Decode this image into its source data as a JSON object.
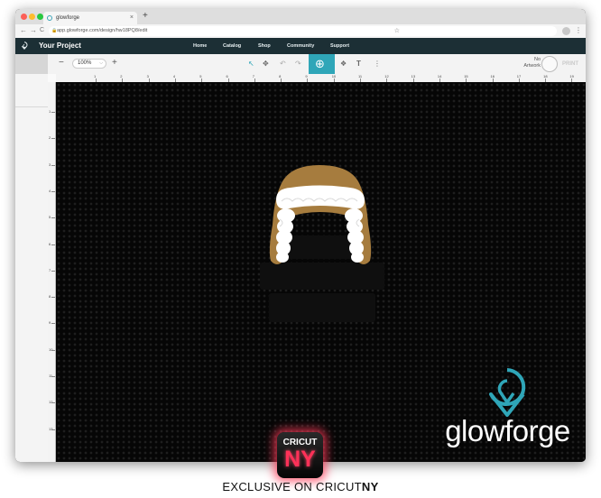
{
  "browser": {
    "tab_title": "glowforge",
    "new_tab": "+",
    "tab_close": "×",
    "url": "app.glowforge.com/design/hw18PQ8/edit",
    "lock": "🔒",
    "star": "☆",
    "menu_glyph": "⋮",
    "back": "←",
    "forward": "→",
    "reload": "C"
  },
  "app_nav": {
    "project_title": "Your Project",
    "links": [
      "Home",
      "Catalog",
      "Shop",
      "Community",
      "Support"
    ]
  },
  "toolbar": {
    "zoom_minus": "−",
    "zoom_value": "100%",
    "zoom_caret": "⌵",
    "zoom_plus": "+",
    "tools": {
      "select": "↖",
      "pan": "✥",
      "undo": "↶",
      "redo": "↷",
      "add": "⊕",
      "shapes": "❖",
      "text": "T",
      "more": "⋮"
    },
    "no_artwork_line1": "No",
    "no_artwork_line2": "Artwork",
    "print_label": "PRINT"
  },
  "ruler": {
    "top_numbers": [
      "1",
      "2",
      "3",
      "4",
      "5",
      "6",
      "7",
      "8",
      "9",
      "10",
      "11",
      "12",
      "13",
      "14",
      "15",
      "16",
      "17",
      "18",
      "19"
    ],
    "left_numbers": [
      "1",
      "2",
      "3",
      "4",
      "5",
      "6",
      "7",
      "8",
      "9",
      "10",
      "11",
      "12",
      "13"
    ]
  },
  "canvas": {
    "logo_text": "glowforge"
  },
  "colors": {
    "nav_bg": "#1c2f35",
    "accent": "#2fa6b8",
    "hat_brown": "#a67c3e",
    "badge_red": "#ff3158"
  },
  "badge": {
    "top": "CRICUT",
    "bottom": "NY"
  },
  "caption": {
    "prefix": "EXCLUSIVE ON CRICUT",
    "suffix": "NY"
  }
}
